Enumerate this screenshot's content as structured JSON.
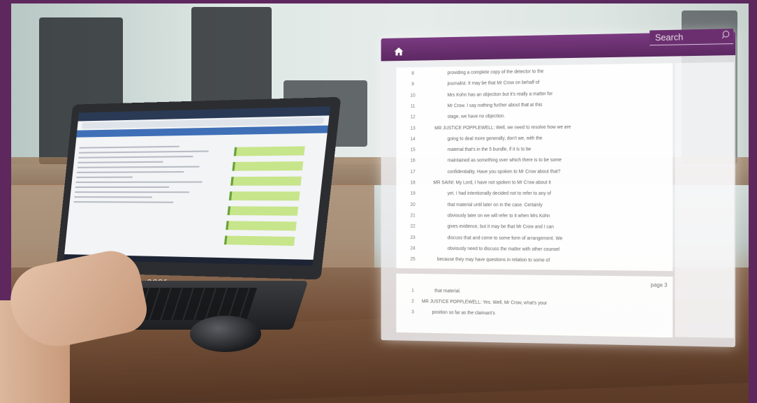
{
  "laptop": {
    "brand": "acer"
  },
  "transcript": {
    "header": {
      "search_placeholder": "Search",
      "home_icon": "home-icon",
      "search_icon": "search-icon",
      "accent_color": "#6b2f70"
    },
    "lines_page2": [
      {
        "num": "8",
        "text": "providing a complete copy of the detector to the"
      },
      {
        "num": "9",
        "text": "journalist.  It may be that Mr Crow on behalf of"
      },
      {
        "num": "10",
        "text": "Mrs Kohn has an objection but it's really a matter for"
      },
      {
        "num": "11",
        "text": "Mr Crow.  I say nothing further about that at this"
      },
      {
        "num": "12",
        "text": "stage, we have no objection."
      },
      {
        "num": "13",
        "text": "MR JUSTICE POPPLEWELL:  Well, we need to resolve how we are"
      },
      {
        "num": "14",
        "text": "going to deal more generally, don't we, with the"
      },
      {
        "num": "15",
        "text": "material that's in the 5 bundle, if it is to be"
      },
      {
        "num": "16",
        "text": "maintained as something over which there is to be some"
      },
      {
        "num": "17",
        "text": "confidentiality.  Have you spoken to Mr Crow about that?"
      },
      {
        "num": "18",
        "text": "MR SAINI:  My Lord, I have not spoken to Mr Crow about it"
      },
      {
        "num": "19",
        "text": "yet.  I had intentionally decided not to refer to any of"
      },
      {
        "num": "20",
        "text": "that material until later on in the case.  Certainly"
      },
      {
        "num": "21",
        "text": "obviously later on we will refer to it when Mrs Kohn"
      },
      {
        "num": "22",
        "text": "gives evidence, but it may be that Mr Crow and I can"
      },
      {
        "num": "23",
        "text": "discuss that and come to some form of arrangement.  We"
      },
      {
        "num": "24",
        "text": "obviously need to discuss the matter with other counsel"
      },
      {
        "num": "25",
        "text": "because they may have questions in relation to some of"
      }
    ],
    "page_label": "page 3",
    "lines_page3": [
      {
        "num": "1",
        "text": "that material."
      },
      {
        "num": "2",
        "text": "MR JUSTICE POPPLEWELL:  Yes.  Well, Mr Crow, what's your"
      },
      {
        "num": "3",
        "text": "position so far as the claimant's"
      }
    ]
  }
}
